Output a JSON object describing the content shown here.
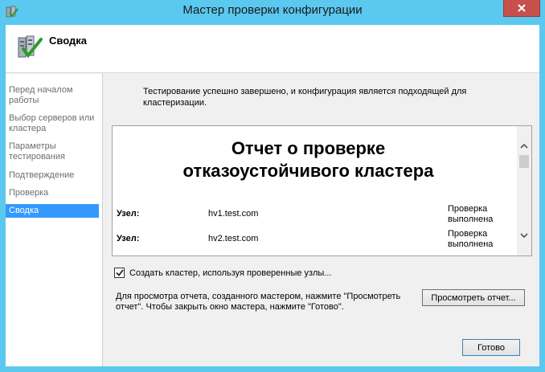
{
  "window": {
    "title": "Мастер проверки конфигурации"
  },
  "header": {
    "title": "Сводка",
    "icon": "checklist-checkmark-icon"
  },
  "sidebar": {
    "items": [
      {
        "label_lines": [
          "Перед началом",
          "работы"
        ],
        "active": false
      },
      {
        "label_lines": [
          "Выбор серверов или",
          "кластера"
        ],
        "active": false
      },
      {
        "label_lines": [
          "Параметры",
          "тестирования"
        ],
        "active": false
      },
      {
        "label_lines": [
          "Подтверждение"
        ],
        "active": false
      },
      {
        "label_lines": [
          "Проверка"
        ],
        "active": false
      },
      {
        "label_lines": [
          "Сводка"
        ],
        "active": true
      }
    ]
  },
  "main": {
    "message_lines": [
      "Тестирование успешно завершено, и конфигурация является подходящей для",
      "кластеризации."
    ],
    "report": {
      "title_lines": [
        "Отчет о проверке",
        "отказоустойчивого кластера"
      ],
      "rows": [
        {
          "label": "Узел:",
          "value": "hv1.test.com",
          "status_lines": [
            "Проверка",
            "выполнена"
          ]
        },
        {
          "label": "Узел:",
          "value": "hv2.test.com",
          "status_lines": [
            "Проверка",
            "выполнена"
          ]
        }
      ]
    },
    "checkbox": {
      "label": "Создать кластер, используя проверенные узлы...",
      "checked": true
    },
    "hint_lines": [
      "Для просмотра отчета, созданного мастером, нажмите  \"Просмотреть",
      "отчет\". Чтобы закрыть окно мастера, нажмите \"Готово\"."
    ],
    "view_report_label": "Просмотреть отчет...",
    "finish_label": "Готово"
  },
  "colors": {
    "titlebar": "#5bc8f0",
    "close": "#c7504c",
    "selection": "#3399ff"
  }
}
